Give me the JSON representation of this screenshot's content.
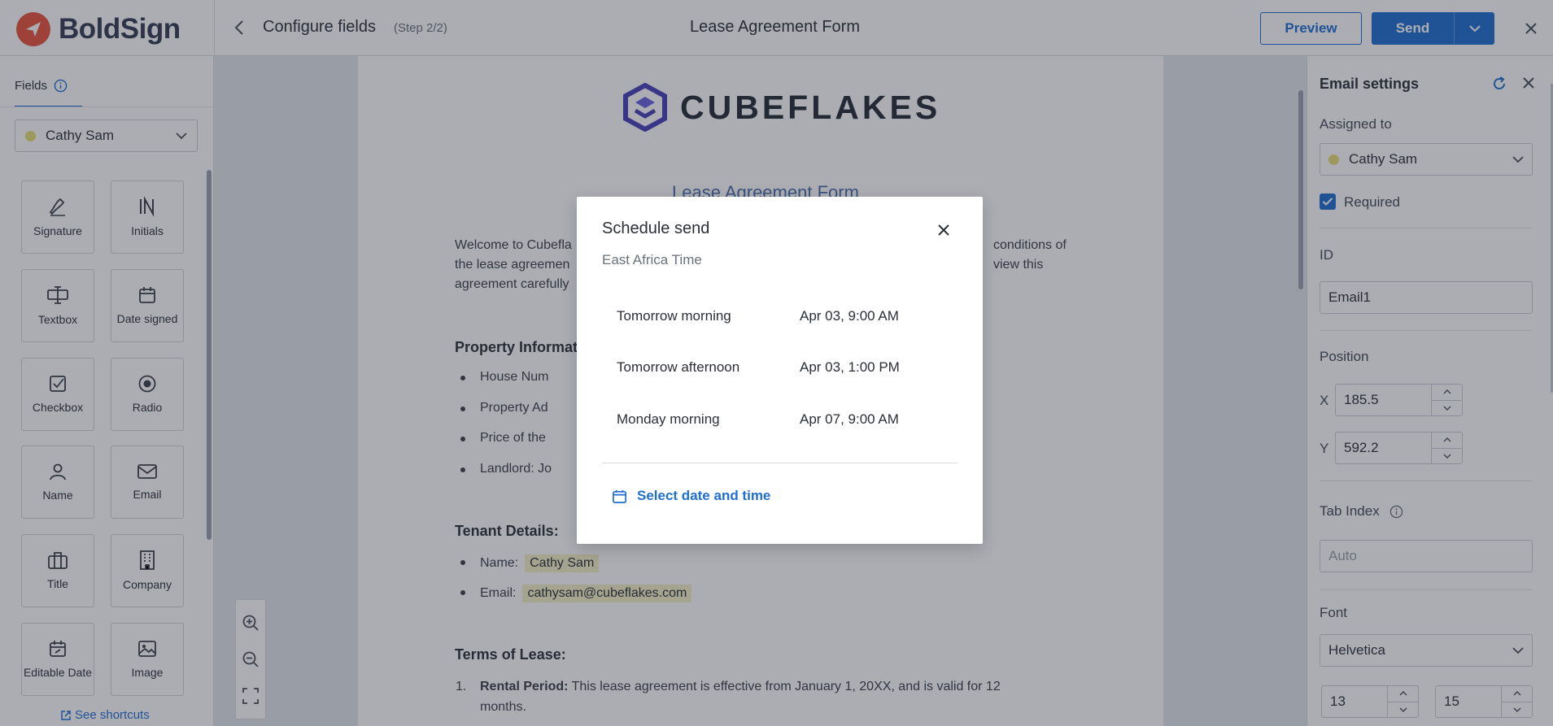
{
  "header": {
    "brand": "BoldSign",
    "title": "Configure fields",
    "step": "(Step 2/2)",
    "document_title": "Lease Agreement Form",
    "preview_label": "Preview",
    "send_label": "Send"
  },
  "left_panel": {
    "tab_label": "Fields",
    "signer": "Cathy Sam",
    "fields": [
      "Signature",
      "Initials",
      "Textbox",
      "Date signed",
      "Checkbox",
      "Radio",
      "Name",
      "Email",
      "Title",
      "Company",
      "Editable Date",
      "Image"
    ],
    "shortcuts_label": "See shortcuts"
  },
  "document": {
    "company": "CUBEFLAKES",
    "heading": "Lease Agreement Form",
    "intro_line1": "Welcome to Cubefla",
    "intro_line1_end": "conditions of",
    "intro_line2": "the lease agreemen",
    "intro_line2_end": "view this",
    "intro_line3": "agreement carefully",
    "property_title": "Property Informat",
    "property_items": [
      "House Num",
      "Property Ad",
      "Price of the",
      "Landlord: Jo"
    ],
    "tenant_title": "Tenant Details:",
    "tenant_name_label": "Name:",
    "tenant_name_value": "Cathy Sam",
    "tenant_email_label": "Email:",
    "tenant_email_value": "cathysam@cubeflakes.com",
    "terms_title": "Terms of Lease:",
    "term1_num": "1.",
    "term1_label": "Rental Period:",
    "term1_text": " This lease agreement is effective from January 1, 20XX, and is valid for 12 months."
  },
  "right_panel": {
    "title": "Email settings",
    "assigned_label": "Assigned to",
    "assigned_value": "Cathy Sam",
    "required_label": "Required",
    "id_label": "ID",
    "id_value": "Email1",
    "position_label": "Position",
    "x_label": "X",
    "x_value": "185.5",
    "y_label": "Y",
    "y_value": "592.2",
    "tab_index_label": "Tab Index",
    "tab_index_placeholder": "Auto",
    "font_label": "Font",
    "font_value": "Helvetica",
    "font_size": "13",
    "line_height": "15"
  },
  "modal": {
    "title": "Schedule send",
    "timezone": "East Africa Time",
    "options": [
      {
        "label": "Tomorrow morning",
        "time": "Apr 03, 9:00 AM"
      },
      {
        "label": "Tomorrow afternoon",
        "time": "Apr 03, 1:00 PM"
      },
      {
        "label": "Monday morning",
        "time": "Apr 07, 9:00 AM"
      }
    ],
    "select_label": "Select date and time"
  },
  "colors": {
    "accent": "#1f6fd1",
    "brand": "#e8523a",
    "signer_dot": "#e8df74",
    "field_highlight": "#f4f0c5"
  }
}
